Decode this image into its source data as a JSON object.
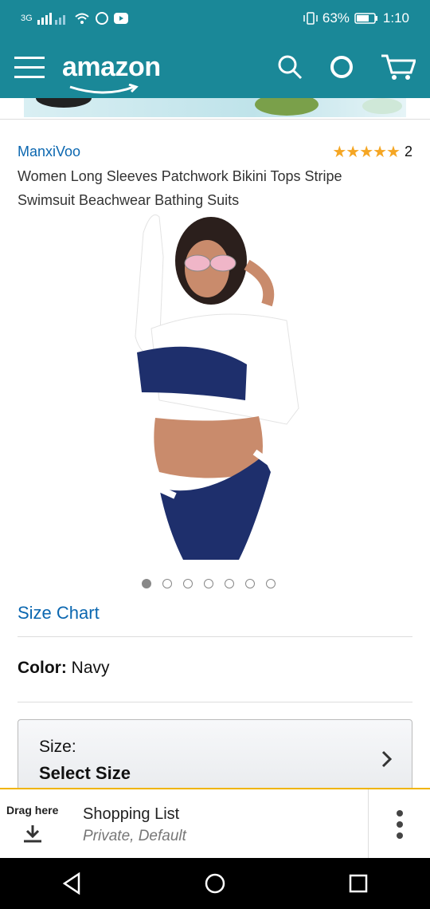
{
  "status": {
    "network": "3G",
    "battery": "63%",
    "time": "1:10"
  },
  "appbar": {
    "logo_text": "amazon",
    "icons": [
      "menu-icon",
      "search-icon",
      "alexa-icon",
      "cart-icon"
    ]
  },
  "product": {
    "brand": "ManxiVoo",
    "rating_count": "2",
    "stars": "★★★★★",
    "title": "Women Long Sleeves Patchwork Bikini Tops Stripe Swimsuit Beachwear Bathing Suits",
    "image_count": 7,
    "active_image_index": 0
  },
  "size_chart": {
    "label": "Size Chart"
  },
  "color": {
    "label": "Color:",
    "value": "Navy"
  },
  "size": {
    "label": "Size:",
    "value": "Select Size"
  },
  "shopping_list": {
    "drag_label": "Drag here",
    "title": "Shopping List",
    "subtitle": "Private, Default"
  },
  "colors": {
    "header": "#1a8898",
    "link": "#0b67b0",
    "star": "#f5a623",
    "accent": "#f0b400"
  }
}
